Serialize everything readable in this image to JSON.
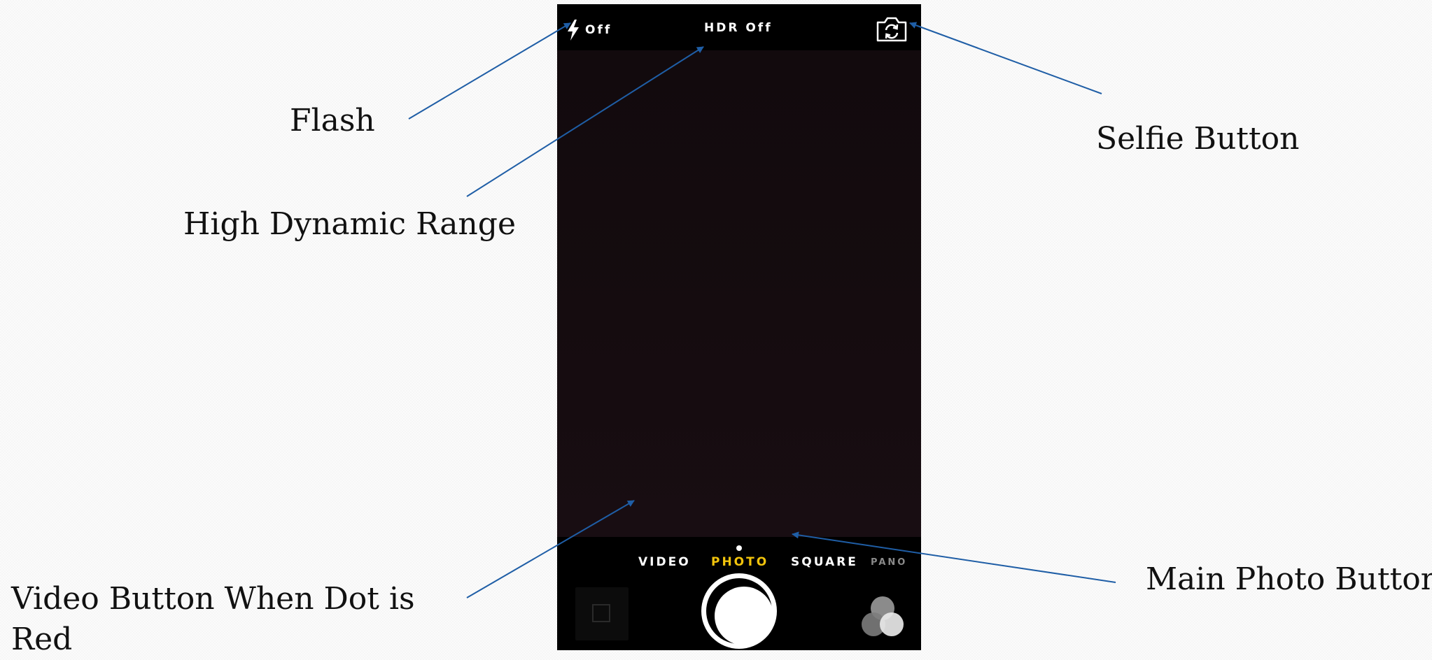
{
  "camera": {
    "flash": {
      "icon": "flash-bolt-icon",
      "status": "Off"
    },
    "hdr": {
      "label": "HDR Off"
    },
    "selfie": {
      "icon": "camera-flip-icon"
    },
    "modes": [
      "VIDEO",
      "PHOTO",
      "SQUARE",
      "PANO"
    ],
    "selected_mode": "PHOTO",
    "selected_mode_color": "#f2c40c",
    "shutter": {
      "icon": "shutter-button-icon"
    },
    "filters": {
      "icon": "filters-circles-icon"
    },
    "thumbnail": {
      "icon": "photo-thumbnail-icon"
    }
  },
  "annotations": {
    "flash": "Flash",
    "hdr": "High Dynamic Range",
    "selfie": "Selfie Button",
    "video": "Video Button When Dot is Red",
    "main_photo": "Main Photo Button",
    "arrow_color": "#1f5ea6"
  }
}
